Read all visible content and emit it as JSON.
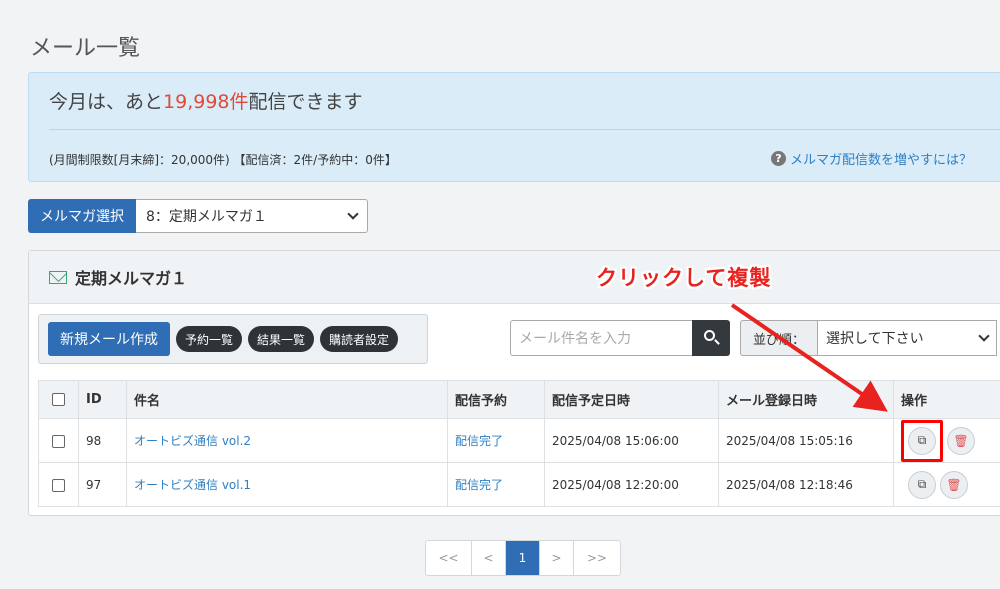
{
  "page": {
    "title": "メール一覧"
  },
  "info": {
    "main_prefix": "今月は、あと",
    "main_highlight": "19,998件",
    "main_suffix": "配信できます",
    "sub": "(月間制限数[月末締]：20,000件) 【配信済：2件/予約中：0件】",
    "help_link": "メルマガ配信数を増やすには？",
    "help_icon": "question-circle-icon"
  },
  "magazine_select": {
    "label": "メルマガ選択",
    "selected": "8：定期メルマガ１"
  },
  "panel": {
    "title": "定期メルマガ１",
    "toolbar": {
      "new_mail": "新規メール作成",
      "reservations": "予約一覧",
      "results": "結果一覧",
      "subscriber_settings": "購読者設定"
    },
    "search": {
      "placeholder": "メール件名を入力"
    },
    "sort": {
      "label": "並び順：",
      "selected": "選択して下さい"
    },
    "table": {
      "headers": [
        "",
        "ID",
        "件名",
        "配信予約",
        "配信予定日時",
        "メール登録日時",
        "操作"
      ],
      "rows": [
        {
          "id": "98",
          "subject": "オートビズ通信 vol.2",
          "reservation": "配信完了",
          "scheduled": "2025/04/08 15:06:00",
          "registered": "2025/04/08 15:05:16"
        },
        {
          "id": "97",
          "subject": "オートビズ通信 vol.1",
          "reservation": "配信完了",
          "scheduled": "2025/04/08 12:20:00",
          "registered": "2025/04/08 12:18:46"
        }
      ]
    }
  },
  "pagination": {
    "first": "<<",
    "prev": "<",
    "current": "1",
    "next": ">",
    "last": ">>"
  },
  "annotation": {
    "text": "クリックして複製",
    "color": "#e8231f"
  },
  "colors": {
    "primary": "#2f6db5",
    "highlight": "#e04a3a",
    "link": "#2f7fc1"
  }
}
